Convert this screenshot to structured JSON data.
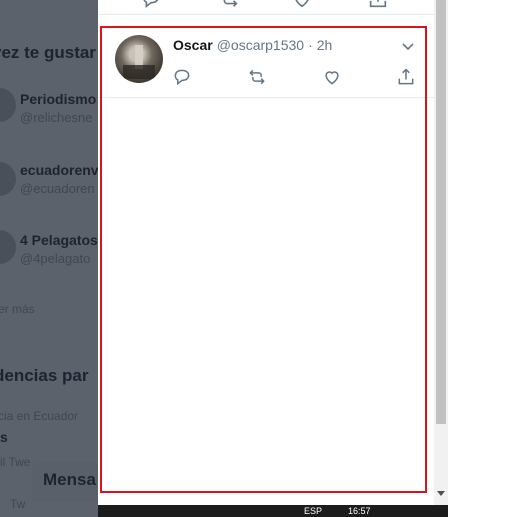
{
  "background": {
    "who_to_follow_heading": "vez te gustar",
    "suggestions": [
      {
        "name": "Periodismo",
        "handle": "@relichesne"
      },
      {
        "name": "ecuadorenv",
        "handle": "@ecuadoren"
      },
      {
        "name": "4 Pelagatos",
        "handle": "@4pelagato"
      }
    ],
    "show_more": "er más",
    "trends_heading": "dencias par",
    "trend_context": "cia en Ecuador",
    "trend_letter": "s",
    "trend_count": "il Twe",
    "trend_small": "Tw",
    "messages_label": "Mensa"
  },
  "tweet": {
    "name": "Oscar",
    "handle": "@oscarp1530",
    "separator": "·",
    "time": "2h"
  },
  "taskbar": {
    "left_text": "ESP",
    "time": "16:57"
  },
  "colors": {
    "focus_border": "#d9141b",
    "overlay": "#5b626b",
    "secondary_text": "#657786"
  }
}
